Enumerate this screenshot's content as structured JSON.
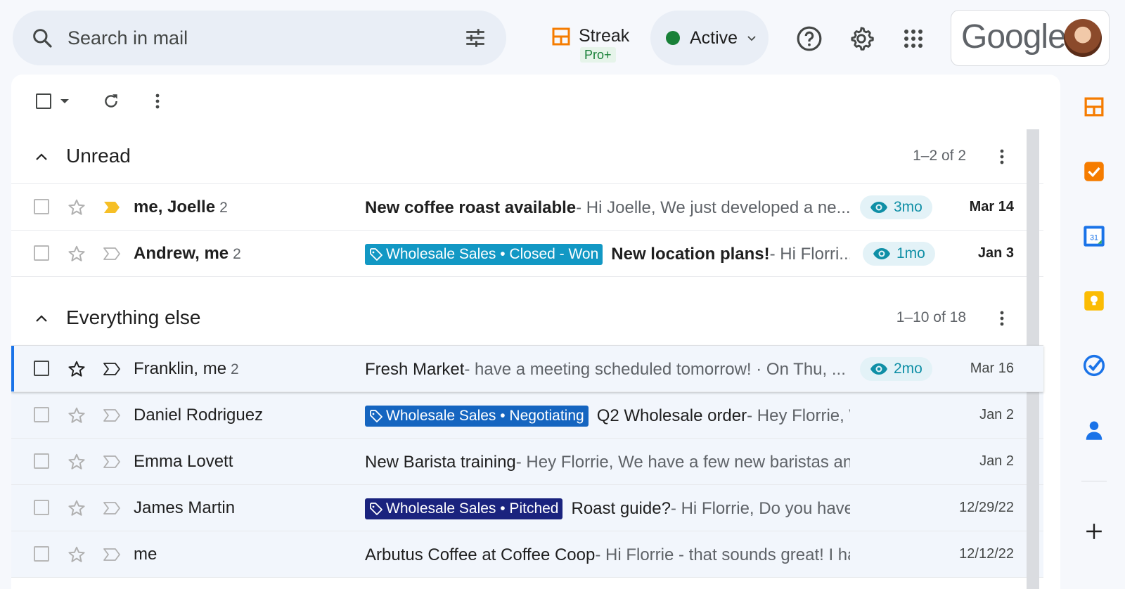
{
  "search": {
    "placeholder": "Search in mail"
  },
  "streak": {
    "name": "Streak",
    "plan": "Pro+"
  },
  "status": {
    "label": "Active",
    "color": "#188038"
  },
  "account": {
    "brand": "Google"
  },
  "sections": [
    {
      "title": "Unread",
      "count": "1–2 of 2"
    },
    {
      "title": "Everything else",
      "count": "1–10 of 18"
    }
  ],
  "unread_rows": [
    {
      "sender": "me, Joelle",
      "count": "2",
      "tag": "",
      "subject": "New coffee roast available",
      "snippet": " - Hi Joelle, We just developed a ne...",
      "views": "3mo",
      "date": "Mar 14",
      "important": true
    },
    {
      "sender": "Andrew, me",
      "count": "2",
      "tag": "Wholesale Sales • Closed - Won",
      "tag_color": "#1298c4",
      "subject": "New location plans!",
      "snippet": " - Hi Florri...",
      "views": "1mo",
      "date": "Jan 3",
      "important": false
    }
  ],
  "other_rows": [
    {
      "sender": "Franklin, me",
      "count": "2",
      "tag": "",
      "subject": "Fresh Market",
      "snippet": " - have a meeting scheduled tomorrow! · On Thu, ...",
      "views": "2mo",
      "date": "Mar 16"
    },
    {
      "sender": "Daniel Rodriguez",
      "count": "",
      "tag": "Wholesale Sales • Negotiating",
      "tag_color": "#1565c0",
      "subject": "Q2 Wholesale order",
      "snippet": " - Hey Florrie, Wante...",
      "views": "",
      "date": "Jan 2"
    },
    {
      "sender": "Emma Lovett",
      "count": "",
      "tag": "",
      "subject": "New Barista training",
      "snippet": " - Hey Florrie, We have a few new baristas and wa...",
      "views": "",
      "date": "Jan 2"
    },
    {
      "sender": "James Martin",
      "count": "",
      "tag": "Wholesale Sales • Pitched",
      "tag_color": "#1a237e",
      "subject": "Roast guide?",
      "snippet": " - Hi Florrie, Do you have a roa...",
      "views": "",
      "date": "12/29/22"
    },
    {
      "sender": "me",
      "count": "",
      "tag": "",
      "subject": "Arbutus Coffee at Coffee Coop",
      "snippet": " - Hi Florrie - that sounds great! I have ...",
      "views": "",
      "date": "12/12/22"
    }
  ],
  "colors": {
    "streak_orange": "#f57c00",
    "view_teal": "#0f8fa6",
    "accent_blue": "#1a73e8"
  }
}
